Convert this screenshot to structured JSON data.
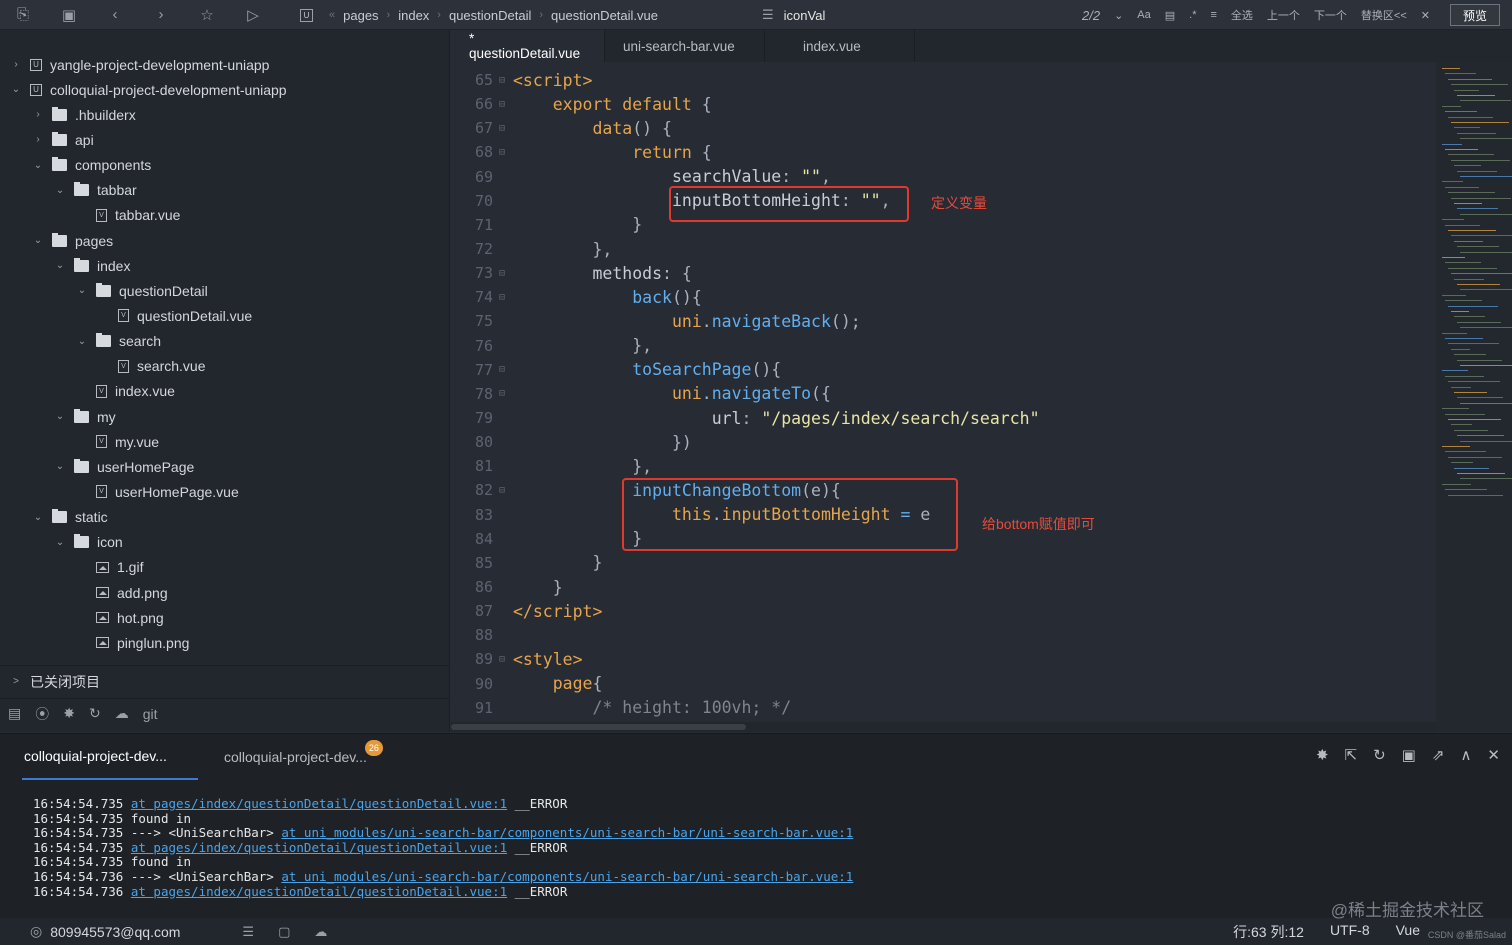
{
  "topbar": {
    "breadcrumbs": [
      "pages",
      "index",
      "questionDetail",
      "questionDetail.vue"
    ],
    "search_value": "iconVal",
    "find_count": "2/2",
    "find_labels": [
      "Aa",
      "全选",
      "上一个",
      "下一个",
      "替换区<<"
    ],
    "preview_label": "预览"
  },
  "sidebar": {
    "tree": [
      {
        "label": "yangle-project-development-uniapp",
        "depth": 0,
        "kind": "project",
        "chev": ">"
      },
      {
        "label": "colloquial-project-development-uniapp",
        "depth": 0,
        "kind": "project",
        "chev": "v"
      },
      {
        "label": ".hbuilderx",
        "depth": 1,
        "kind": "folder",
        "chev": ">"
      },
      {
        "label": "api",
        "depth": 1,
        "kind": "folder",
        "chev": ">"
      },
      {
        "label": "components",
        "depth": 1,
        "kind": "folder",
        "chev": "v"
      },
      {
        "label": "tabbar",
        "depth": 2,
        "kind": "folder",
        "chev": "v"
      },
      {
        "label": "tabbar.vue",
        "depth": 3,
        "kind": "file",
        "chev": ""
      },
      {
        "label": "pages",
        "depth": 1,
        "kind": "folder",
        "chev": "v"
      },
      {
        "label": "index",
        "depth": 2,
        "kind": "folder",
        "chev": "v"
      },
      {
        "label": "questionDetail",
        "depth": 3,
        "kind": "folder",
        "chev": "v"
      },
      {
        "label": "questionDetail.vue",
        "depth": 4,
        "kind": "file",
        "chev": ""
      },
      {
        "label": "search",
        "depth": 3,
        "kind": "folder",
        "chev": "v"
      },
      {
        "label": "search.vue",
        "depth": 4,
        "kind": "file",
        "chev": ""
      },
      {
        "label": "index.vue",
        "depth": 3,
        "kind": "file",
        "chev": ""
      },
      {
        "label": "my",
        "depth": 2,
        "kind": "folder",
        "chev": "v"
      },
      {
        "label": "my.vue",
        "depth": 3,
        "kind": "file",
        "chev": ""
      },
      {
        "label": "userHomePage",
        "depth": 2,
        "kind": "folder",
        "chev": "v"
      },
      {
        "label": "userHomePage.vue",
        "depth": 3,
        "kind": "file",
        "chev": ""
      },
      {
        "label": "static",
        "depth": 1,
        "kind": "folder",
        "chev": "v"
      },
      {
        "label": "icon",
        "depth": 2,
        "kind": "folder",
        "chev": "v"
      },
      {
        "label": "1.gif",
        "depth": 3,
        "kind": "image",
        "chev": ""
      },
      {
        "label": "add.png",
        "depth": 3,
        "kind": "image",
        "chev": ""
      },
      {
        "label": "hot.png",
        "depth": 3,
        "kind": "image",
        "chev": ""
      },
      {
        "label": "pinglun.png",
        "depth": 3,
        "kind": "image",
        "chev": ""
      }
    ],
    "closed_projects": "已关闭项目",
    "git_label": "git"
  },
  "editor": {
    "tabs": [
      "* questionDetail.vue",
      "uni-search-bar.vue",
      "index.vue"
    ],
    "lines": [
      {
        "n": "65",
        "fold": true,
        "html": "<span class='tag'>&lt;script&gt;</span>"
      },
      {
        "n": "66",
        "fold": true,
        "html": "    <span class='kw'>export default</span> {"
      },
      {
        "n": "67",
        "fold": true,
        "html": "        <span class='kw'>data</span>() {"
      },
      {
        "n": "68",
        "fold": true,
        "html": "            <span class='kw'>return</span> {"
      },
      {
        "n": "69",
        "fold": false,
        "html": "                <span class='prop'>searchValue</span>: <span class='str'>\"\"</span>,"
      },
      {
        "n": "70",
        "fold": false,
        "html": "                <span class='prop'>inputBottomHeight</span>: <span class='str'>\"\"</span>,"
      },
      {
        "n": "71",
        "fold": false,
        "html": "            }"
      },
      {
        "n": "72",
        "fold": false,
        "html": "        },"
      },
      {
        "n": "73",
        "fold": true,
        "html": "        <span class='prop'>methods</span>: {"
      },
      {
        "n": "74",
        "fold": true,
        "html": "            <span class='fn'>back</span>(){"
      },
      {
        "n": "75",
        "fold": false,
        "html": "                <span class='kw'>uni</span>.<span class='fn'>navigateBack</span>();"
      },
      {
        "n": "76",
        "fold": false,
        "html": "            },"
      },
      {
        "n": "77",
        "fold": true,
        "html": "            <span class='fn'>toSearchPage</span>(){"
      },
      {
        "n": "78",
        "fold": true,
        "html": "                <span class='kw'>uni</span>.<span class='fn'>navigateTo</span>({"
      },
      {
        "n": "79",
        "fold": false,
        "html": "                    <span class='prop'>url</span>: <span class='str'>\"/pages/index/search/search\"</span>"
      },
      {
        "n": "80",
        "fold": false,
        "html": "                })"
      },
      {
        "n": "81",
        "fold": false,
        "html": "            },"
      },
      {
        "n": "82",
        "fold": true,
        "html": "            <span class='fn'>inputChangeBottom</span>(e){"
      },
      {
        "n": "83",
        "fold": false,
        "html": "                <span class='kw'>this</span>.<span class='kw'>inputBottomHeight</span> <span class='fn'>=</span> e"
      },
      {
        "n": "84",
        "fold": false,
        "html": "            }"
      },
      {
        "n": "85",
        "fold": false,
        "html": "        }"
      },
      {
        "n": "86",
        "fold": false,
        "html": "    }"
      },
      {
        "n": "87",
        "fold": false,
        "html": "<span class='tag'>&lt;/script&gt;</span>"
      },
      {
        "n": "88",
        "fold": false,
        "html": ""
      },
      {
        "n": "89",
        "fold": true,
        "html": "<span class='tag'>&lt;style&gt;</span>"
      },
      {
        "n": "90",
        "fold": false,
        "html": "    <span class='kw'>page</span>{"
      },
      {
        "n": "91",
        "fold": false,
        "html": "        <span class='cmt'>/* height: 100vh; */</span>"
      }
    ],
    "annotation1": "定义变量",
    "annotation2": "给bottom赋值即可"
  },
  "console": {
    "tabs": [
      "colloquial-project-dev...",
      "colloquial-project-dev..."
    ],
    "badge": "26",
    "logs": [
      {
        "ts": "16:54:54.735",
        "pre": "",
        "link": "at pages/index/questionDetail/questionDetail.vue:1",
        "post": " __ERROR"
      },
      {
        "ts": "16:54:54.735",
        "pre": "found in",
        "link": "",
        "post": ""
      },
      {
        "ts": "16:54:54.735",
        "pre": "---> <UniSearchBar> ",
        "link": "at uni_modules/uni-search-bar/components/uni-search-bar/uni-search-bar.vue:1",
        "post": ""
      },
      {
        "ts": "16:54:54.735",
        "pre": "",
        "link": "at pages/index/questionDetail/questionDetail.vue:1",
        "post": " __ERROR"
      },
      {
        "ts": "16:54:54.735",
        "pre": "found in",
        "link": "",
        "post": ""
      },
      {
        "ts": "16:54:54.736",
        "pre": "---> <UniSearchBar> ",
        "link": "at uni_modules/uni-search-bar/components/uni-search-bar/uni-search-bar.vue:1",
        "post": ""
      },
      {
        "ts": "16:54:54.736",
        "pre": "",
        "link": "at pages/index/questionDetail/questionDetail.vue:1",
        "post": " __ERROR"
      }
    ]
  },
  "status": {
    "user": "809945573@qq.com",
    "position": "行:63  列:12",
    "encoding": "UTF-8",
    "language": "Vue",
    "watermark": "@稀土掘金技术社区",
    "watermark_small": "CSDN @番茄Salad"
  }
}
